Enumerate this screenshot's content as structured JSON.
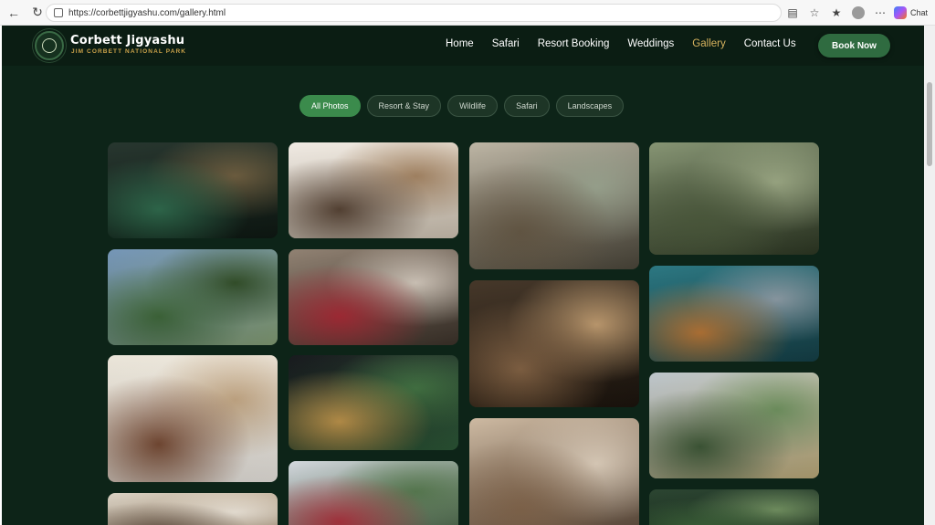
{
  "browser": {
    "url": "https://corbettjigyashu.com/gallery.html",
    "chat_label": "Chat"
  },
  "site": {
    "brand_name": "Corbett Jigyashu",
    "brand_tagline": "JIM CORBETT NATIONAL PARK",
    "nav": [
      "Home",
      "Safari",
      "Resort Booking",
      "Weddings",
      "Gallery",
      "Contact Us"
    ],
    "active_nav": "Gallery",
    "book_label": "Book Now"
  },
  "filters": {
    "items": [
      "All Photos",
      "Resort & Stay",
      "Wildlife",
      "Safari",
      "Landscapes"
    ],
    "active": "All Photos"
  },
  "gallery": {
    "photos": [
      {
        "name": "photo-resort-aerial-night",
        "palette": [
          "#1a2a22",
          "#2f6f4f",
          "#6b5a3a",
          "#0f1a14"
        ]
      },
      {
        "name": "photo-resort-aerial-dusk",
        "palette": [
          "#6c8fb3",
          "#3f6b3a",
          "#2c4a22",
          "#8aa57a"
        ]
      },
      {
        "name": "photo-room-sofa",
        "palette": [
          "#e9e3d6",
          "#7a4b33",
          "#c4a681",
          "#f4f0ea"
        ]
      },
      {
        "name": "photo-room-ceiling-fan",
        "palette": [
          "#d8cfc0",
          "#6b5848",
          "#efe7da",
          "#a48a6c"
        ]
      },
      {
        "name": "photo-bedroom-interior",
        "palette": [
          "#efe9e1",
          "#5a4535",
          "#a4825f",
          "#d9cdbc"
        ]
      },
      {
        "name": "photo-flower-bathtub",
        "palette": [
          "#8a7a6a",
          "#b02a36",
          "#d3c8bb",
          "#3f352c"
        ]
      },
      {
        "name": "photo-resort-pool-night",
        "palette": [
          "#0a0c10",
          "#c79a4c",
          "#3c6e3c",
          "#2f5d3a"
        ]
      },
      {
        "name": "photo-resort-cottages",
        "palette": [
          "#d1d6dc",
          "#b4333f",
          "#53774b",
          "#3a5a37"
        ]
      },
      {
        "name": "photo-striped-hyena",
        "palette": [
          "#b9b19f",
          "#6b5d48",
          "#9aa48e",
          "#4f4a3d"
        ]
      },
      {
        "name": "photo-python-head",
        "palette": [
          "#3a2b1c",
          "#8a6746",
          "#c09a6c",
          "#1d150e"
        ]
      },
      {
        "name": "photo-snake-sand",
        "palette": [
          "#cab59c",
          "#8a6b4f",
          "#e0d0bc",
          "#5a4636"
        ]
      },
      {
        "name": "photo-kingfisher-branch",
        "palette": [
          "#7f8e6b",
          "#4f5e3e",
          "#9ba882",
          "#2f3a25"
        ]
      },
      {
        "name": "photo-tiger-river",
        "palette": [
          "#1f6f7a",
          "#c07a36",
          "#8a9aa4",
          "#16434b"
        ]
      },
      {
        "name": "photo-forest-hills",
        "palette": [
          "#b9c2c8",
          "#3e5a37",
          "#6b8f5a",
          "#c4b27f"
        ]
      },
      {
        "name": "photo-forest-canopy",
        "palette": [
          "#1f3a25",
          "#3f6a3a",
          "#6e8f5c",
          "#132618"
        ]
      }
    ]
  }
}
